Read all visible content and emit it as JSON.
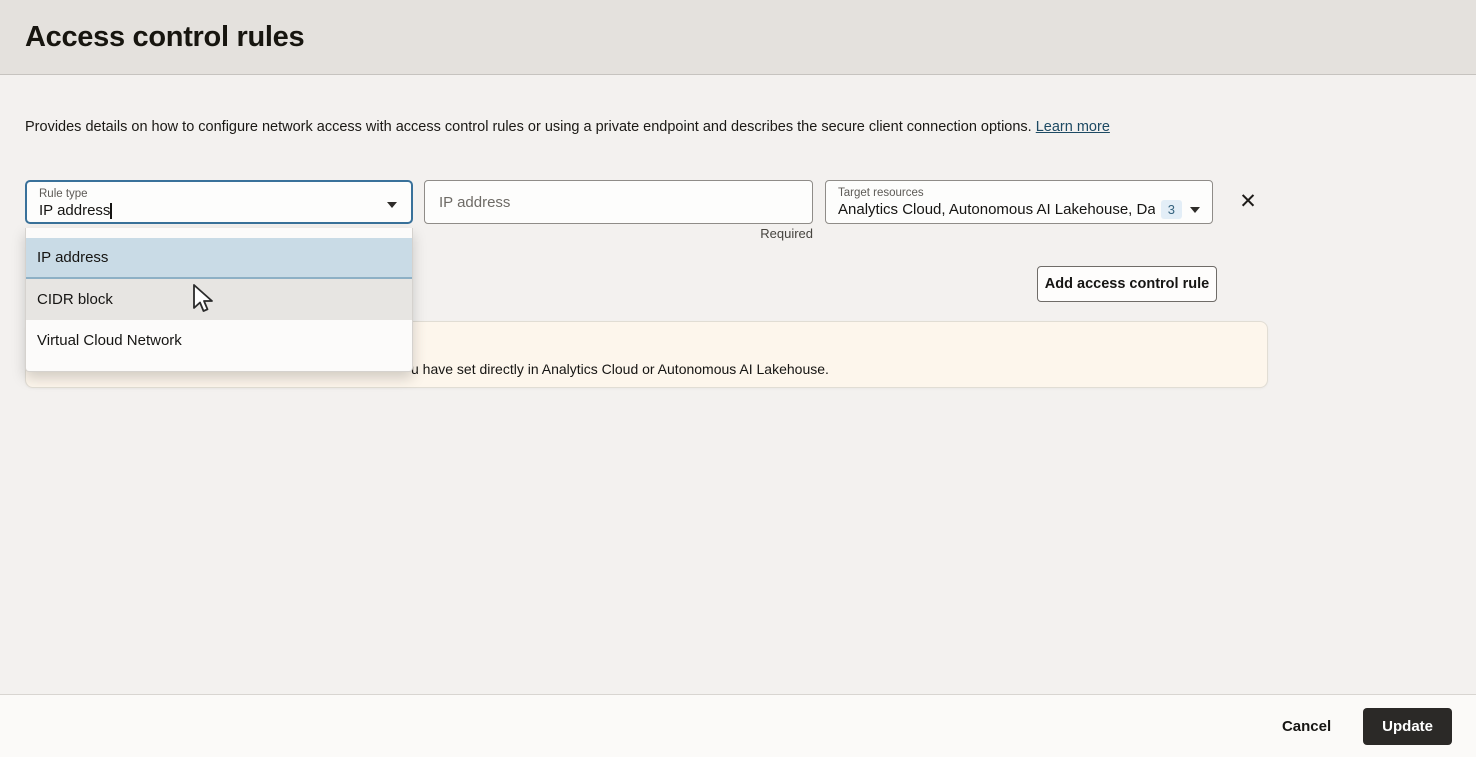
{
  "header": {
    "title": "Access control rules"
  },
  "intro": {
    "text": "Provides details on how to configure network access with access control rules or using a private endpoint and describes the secure client connection options.",
    "learn_more_label": "Learn more"
  },
  "form": {
    "rule_type": {
      "label": "Rule type",
      "value": "IP address"
    },
    "ip_address": {
      "placeholder": "IP address",
      "helper": "Required"
    },
    "target_resources": {
      "label": "Target resources",
      "value": "Analytics Cloud, Autonomous AI Lakehouse, Da",
      "badge_count": "3"
    },
    "remove_icon_glyph": "✕"
  },
  "dropdown": {
    "options": [
      {
        "label": "IP address",
        "state": "selected"
      },
      {
        "label": "CIDR block",
        "state": "hovered"
      },
      {
        "label": "Virtual Cloud Network",
        "state": "default"
      }
    ]
  },
  "actions": {
    "add_rule_label": "Add access control rule"
  },
  "notice": {
    "visible_text": "u have set directly in Analytics Cloud or Autonomous AI Lakehouse."
  },
  "footer": {
    "cancel_label": "Cancel",
    "update_label": "Update"
  },
  "colors": {
    "header_bg": "#e4e1dd",
    "body_bg": "#f3f1ef",
    "focus_border": "#39719a",
    "selected_option_bg": "#c9dbe6",
    "hover_option_bg": "#e7e5e2",
    "notice_bg": "#fdf6ec",
    "badge_bg": "#e3eef7",
    "badge_text": "#35637f",
    "link": "#1d4a63",
    "update_button_bg": "#2b2927"
  }
}
